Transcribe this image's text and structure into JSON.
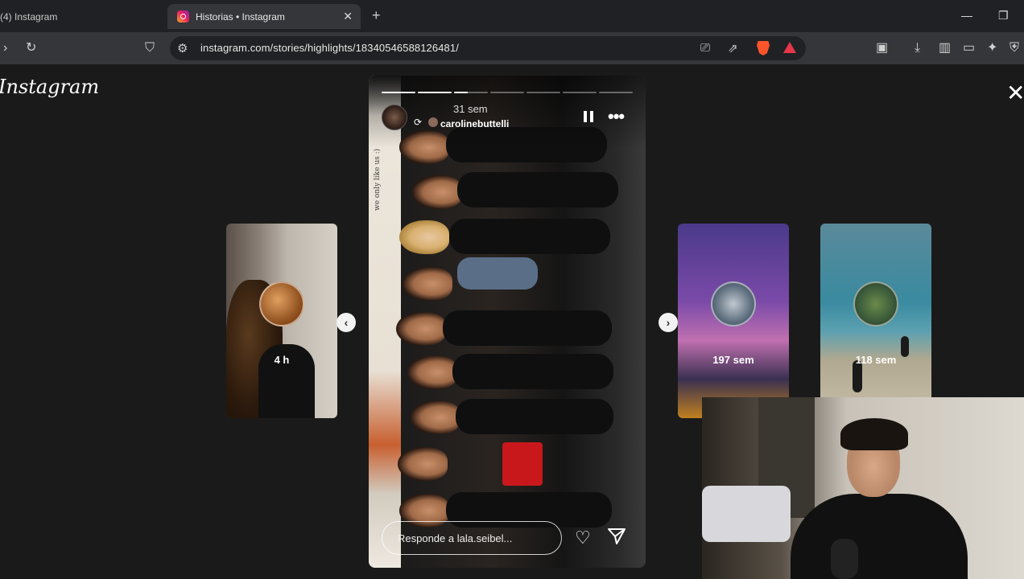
{
  "browser": {
    "tabs": [
      {
        "title": "(4) Instagram"
      },
      {
        "title": "Historias • Instagram",
        "close": "✕"
      }
    ],
    "new_tab": "+",
    "url": "instagram.com/stories/highlights/18340546588126481/"
  },
  "page": {
    "logo": "Instagram",
    "close": "✕"
  },
  "side_stories": [
    {
      "time": "4 h"
    },
    {
      "time": "197 sem"
    },
    {
      "time": "118 sem"
    }
  ],
  "nav": {
    "prev": "‹",
    "next": "›"
  },
  "story": {
    "progress": [
      1,
      1,
      0.4,
      0,
      0,
      0,
      0
    ],
    "time": "31 sem",
    "username": "carolinebuttelli",
    "caption": "we only like us :)",
    "reply_placeholder": "Responde a lala.seibel..."
  }
}
